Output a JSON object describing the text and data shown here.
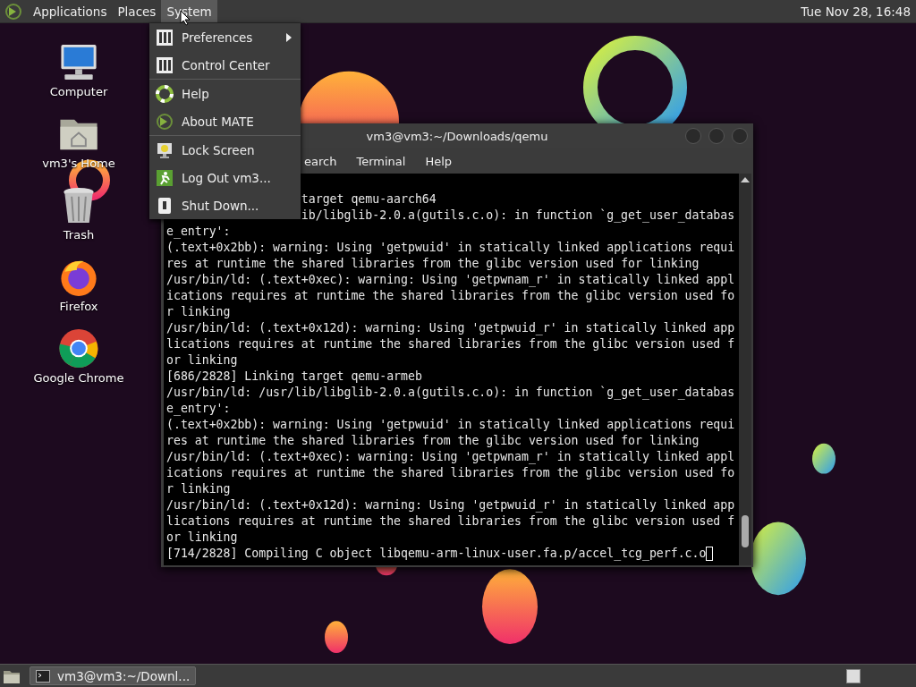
{
  "top_panel": {
    "menus": [
      {
        "label": "Applications",
        "selected": false
      },
      {
        "label": "Places",
        "selected": false
      },
      {
        "label": "System",
        "selected": true
      }
    ],
    "clock": "Tue Nov 28, 16:48"
  },
  "desktop_icons": [
    {
      "label": "Computer"
    },
    {
      "label": "vm3's Home"
    },
    {
      "label": "Trash"
    },
    {
      "label": "Firefox"
    },
    {
      "label": "Google Chrome"
    }
  ],
  "system_menu": {
    "groups": [
      [
        {
          "label": "Preferences",
          "submenu": true
        },
        {
          "label": "Control Center",
          "submenu": false
        }
      ],
      [
        {
          "label": "Help",
          "submenu": false
        },
        {
          "label": "About MATE",
          "submenu": false
        }
      ],
      [
        {
          "label": "Lock Screen",
          "submenu": false
        },
        {
          "label": "Log Out vm3...",
          "submenu": false
        },
        {
          "label": "Shut Down...",
          "submenu": false
        }
      ]
    ]
  },
  "terminal": {
    "title": "vm3@vm3:~/Downloads/qemu",
    "menu": [
      "earch",
      "Terminal",
      "Help"
    ],
    "lines": [
      {
        "kind": "partial",
        "text": "target qemu-aarch64"
      },
      {
        "kind": "partial",
        "text": "ib/libglib-2.0.a(gutils.c.o): in function `g_get_user_databas"
      },
      {
        "kind": "output",
        "text": "e_entry':"
      },
      {
        "kind": "output",
        "text": "(.text+0x2bb): warning: Using 'getpwuid' in statically linked applications requi"
      },
      {
        "kind": "output",
        "text": "res at runtime the shared libraries from the glibc version used for linking"
      },
      {
        "kind": "output",
        "text": "/usr/bin/ld: (.text+0xec): warning: Using 'getpwnam_r' in statically linked appl"
      },
      {
        "kind": "output",
        "text": "ications requires at runtime the shared libraries from the glibc version used fo"
      },
      {
        "kind": "output",
        "text": "r linking"
      },
      {
        "kind": "output",
        "text": "/usr/bin/ld: (.text+0x12d): warning: Using 'getpwuid_r' in statically linked app"
      },
      {
        "kind": "output",
        "text": "lications requires at runtime the shared libraries from the glibc version used f"
      },
      {
        "kind": "output",
        "text": "or linking"
      },
      {
        "kind": "output",
        "text": "[686/2828] Linking target qemu-armeb"
      },
      {
        "kind": "output",
        "text": "/usr/bin/ld: /usr/lib/libglib-2.0.a(gutils.c.o): in function `g_get_user_databas"
      },
      {
        "kind": "output",
        "text": "e_entry':"
      },
      {
        "kind": "output",
        "text": "(.text+0x2bb): warning: Using 'getpwuid' in statically linked applications requi"
      },
      {
        "kind": "output",
        "text": "res at runtime the shared libraries from the glibc version used for linking"
      },
      {
        "kind": "output",
        "text": "/usr/bin/ld: (.text+0xec): warning: Using 'getpwnam_r' in statically linked appl"
      },
      {
        "kind": "output",
        "text": "ications requires at runtime the shared libraries from the glibc version used fo"
      },
      {
        "kind": "output",
        "text": "r linking"
      },
      {
        "kind": "output",
        "text": "/usr/bin/ld: (.text+0x12d): warning: Using 'getpwuid_r' in statically linked app"
      },
      {
        "kind": "output",
        "text": "lications requires at runtime the shared libraries from the glibc version used f"
      },
      {
        "kind": "output",
        "text": "or linking"
      },
      {
        "kind": "prompt",
        "text": "[714/2828] Compiling C object libqemu-arm-linux-user.fa.p/accel_tcg_perf.c.o"
      }
    ]
  },
  "bottom_panel": {
    "task": "vm3@vm3:~/Downl..."
  }
}
